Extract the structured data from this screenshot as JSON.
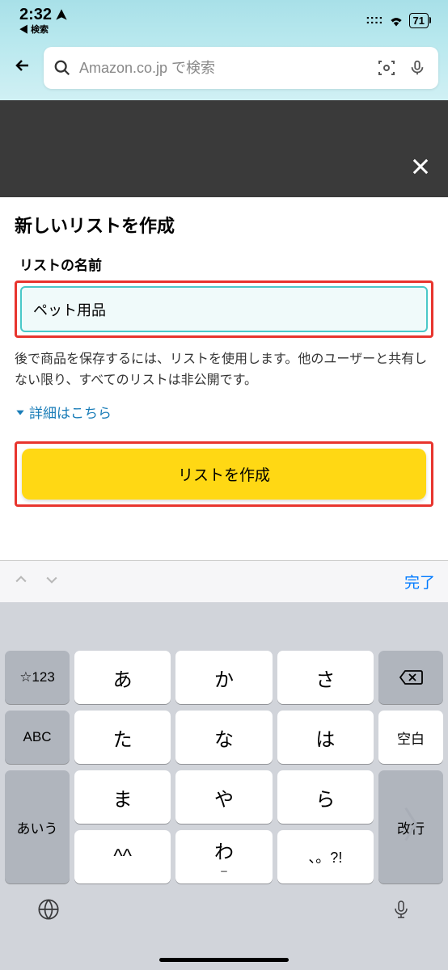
{
  "status": {
    "time": "2:32",
    "back_app": "◀ 検索",
    "signal_icon": "signal",
    "wifi_icon": "wifi",
    "battery": "71"
  },
  "search": {
    "placeholder": "Amazon.co.jp で検索"
  },
  "page": {
    "title": "新しいリストを作成",
    "field_label": "リストの名前",
    "input_value": "ペット用品",
    "help_text": "後で商品を保存するには、リストを使用します。他のユーザーと共有しない限り、すべてのリストは非公開です。",
    "details_link": "詳細はこちら",
    "create_button": "リストを作成"
  },
  "keyboard": {
    "done": "完了",
    "left_keys": [
      "☆123",
      "ABC",
      "あいう"
    ],
    "mid_rows": [
      [
        "あ",
        "か",
        "さ"
      ],
      [
        "た",
        "な",
        "は"
      ],
      [
        "ま",
        "や",
        "ら"
      ],
      [
        "^^",
        "わ",
        "、。?!"
      ]
    ],
    "right_keys": [
      "⌫",
      "空白",
      "改行"
    ],
    "underscore": "_"
  }
}
